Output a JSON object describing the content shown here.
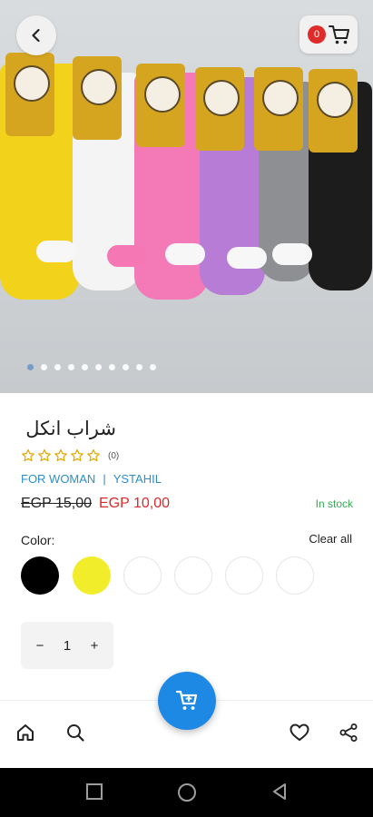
{
  "product": {
    "title": "شراب انكل",
    "rating_count": "(0)",
    "category": "FOR WOMAN",
    "separator": "|",
    "brand": "YSTAHIL",
    "old_price": "EGP 15,00",
    "price": "EGP 10,00",
    "stock_status": "In stock",
    "rating": 0,
    "rating_max": 5
  },
  "header": {
    "cart_count": "0"
  },
  "gallery": {
    "image_count": 10,
    "active_index": 0
  },
  "color": {
    "label": "Color:",
    "clear_label": "Clear all",
    "swatches": [
      "#000000",
      "#f2ed2a",
      "#ffffff",
      "#ffffff",
      "#ffffff",
      "#ffffff"
    ]
  },
  "quantity": {
    "minus": "−",
    "value": "1",
    "plus": "+"
  },
  "colors": {
    "accent": "#1e88e5",
    "price_red": "#d82b2b",
    "stock_green": "#3aa853",
    "link_blue": "#2f8fc6",
    "star": "#e0a800"
  },
  "icons": [
    "back-icon",
    "cart-icon",
    "home-icon",
    "search-icon",
    "heart-icon",
    "share-icon",
    "cart-fab-icon"
  ]
}
